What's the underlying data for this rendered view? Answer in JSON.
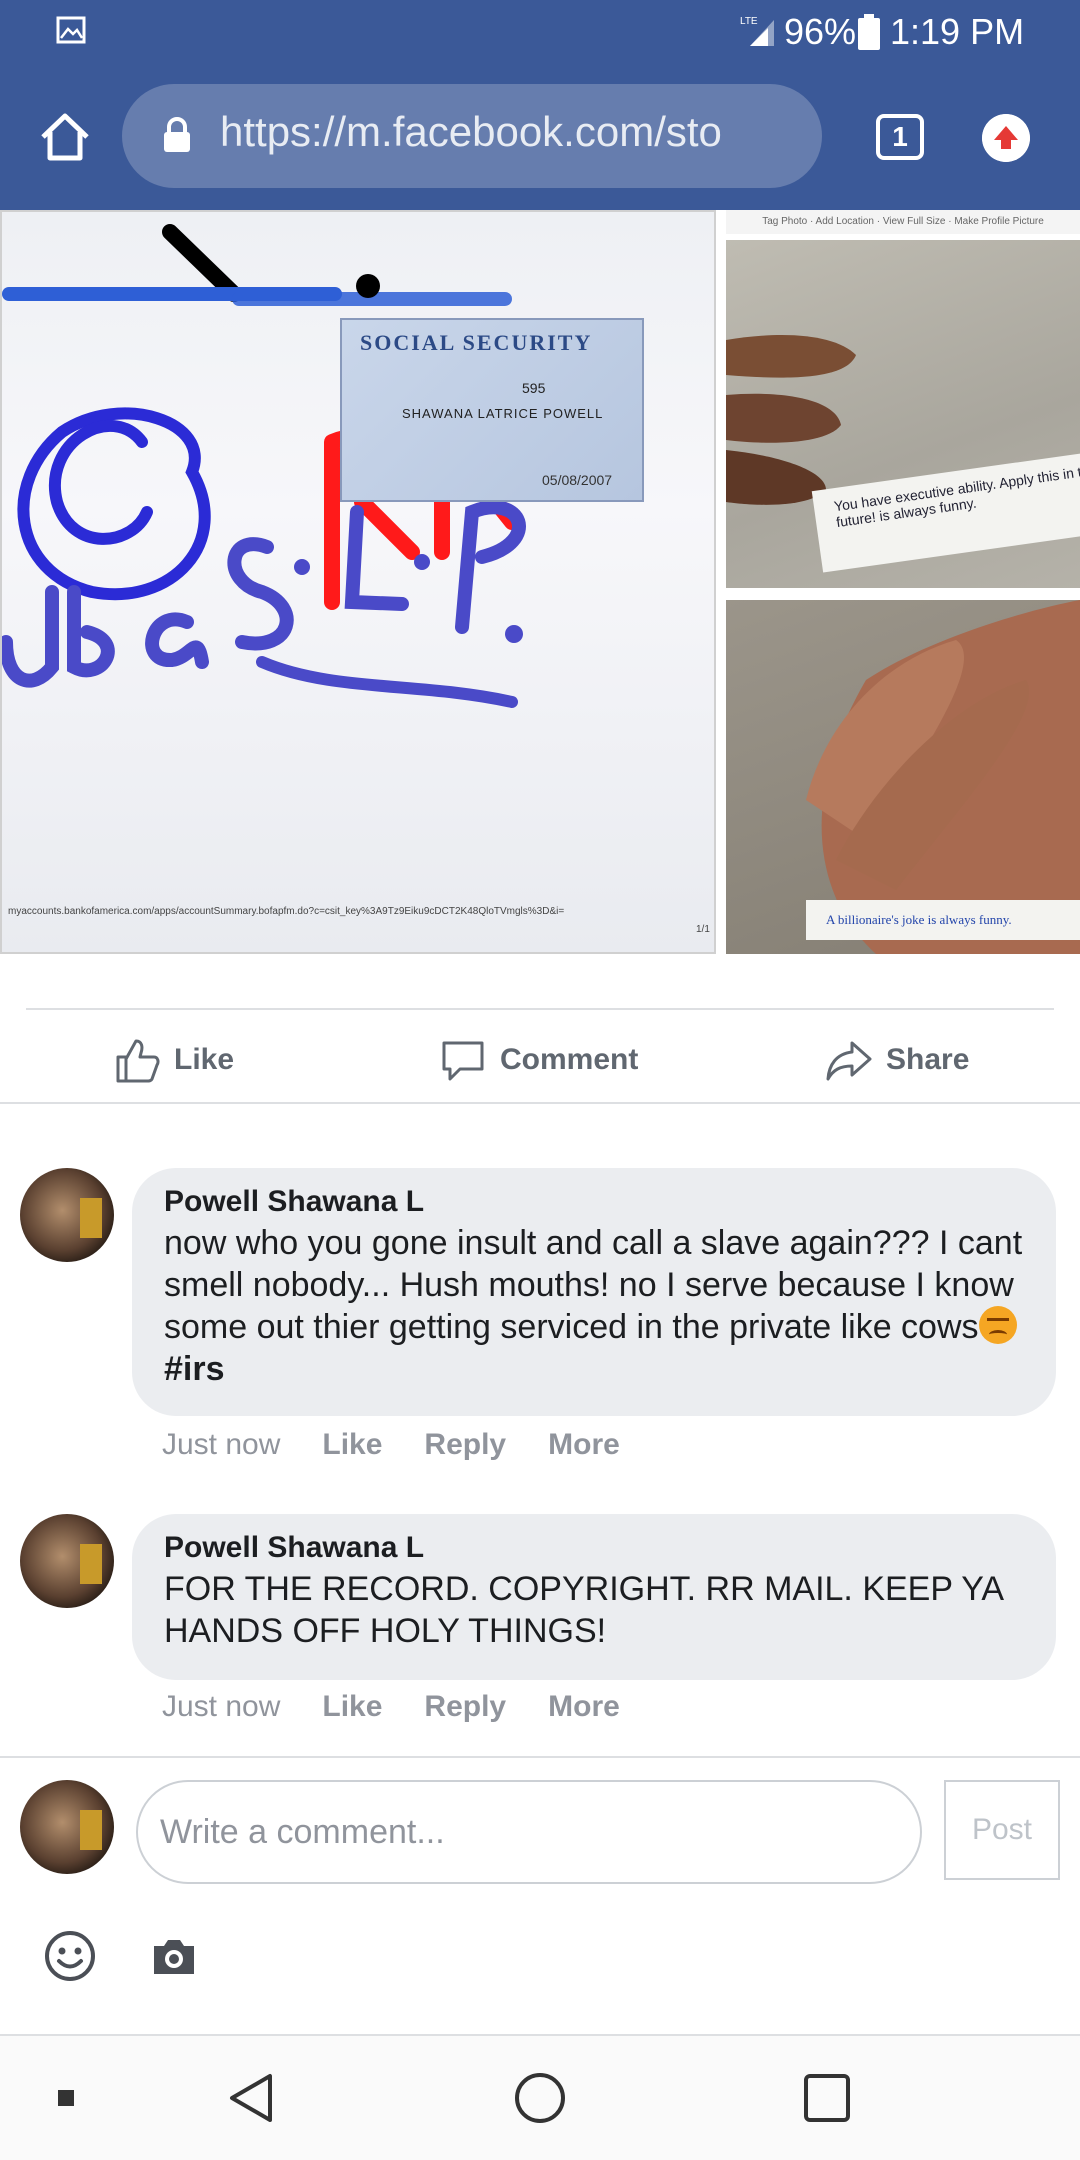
{
  "status_bar": {
    "network": "LTE",
    "battery_percent": "96%",
    "time": "1:19 PM",
    "icons": [
      "gallery-icon",
      "signal-icon",
      "battery-icon"
    ]
  },
  "browser": {
    "url": "https://m.facebook.com/sto",
    "tab_count": "1",
    "icons": [
      "home-icon",
      "lock-icon",
      "tabs-icon",
      "update-icon"
    ]
  },
  "post_photos": {
    "card_title": "SOCIAL SECURITY",
    "card_number_fragment": "595",
    "card_name": "SHAWANA LATRICE POWELL",
    "card_date": "05/08/2007",
    "handwriting_rr": "RR",
    "handwriting_dba": "dba S.L.P.",
    "url_footer": "myaccounts.bankofamerica.com/apps/accountSummary.bofapfm.do?c=csit_key%3A9Tz9Eiku9cDCT2K48QloTVmgls%3D&i=",
    "page_number": "1/1",
    "photo_strip": "Tag Photo · Add Location · View Full Size · Make Profile Picture",
    "fortune_1": "You have executive ability. Apply this in the future!",
    "fortune_1_tail": "is always funny.",
    "fortune_2": "A billionaire's joke is always funny."
  },
  "actions": {
    "like": "Like",
    "comment": "Comment",
    "share": "Share"
  },
  "comments": [
    {
      "author": "Powell Shawana L",
      "text": "now who you gone insult and call a slave again??? I cant smell nobody... Hush mouths! no I serve because I know some out thier getting serviced in the private like cows",
      "hashtag": "#irs",
      "time": "Just now",
      "like": "Like",
      "reply": "Reply",
      "more": "More"
    },
    {
      "author": "Powell Shawana L",
      "text": "FOR THE RECORD. COPYRIGHT. RR MAIL. KEEP YA HANDS OFF HOLY THINGS!",
      "time": "Just now",
      "like": "Like",
      "reply": "Reply",
      "more": "More"
    }
  ],
  "composer": {
    "placeholder": "Write a comment...",
    "post_label": "Post",
    "icons": [
      "emoji-icon",
      "camera-icon"
    ]
  },
  "nav_bar": {
    "icons": [
      "recents-dot-icon",
      "back-icon",
      "home-circle-icon",
      "overview-icon"
    ]
  },
  "colors": {
    "facebook_blue": "#3b5998",
    "bubble_gray": "#ebedf0",
    "meta_gray": "#90949c",
    "action_gray": "#606770"
  }
}
